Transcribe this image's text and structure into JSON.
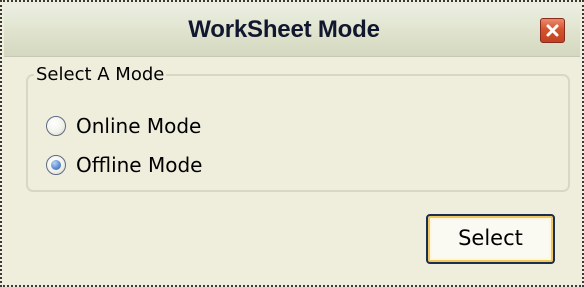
{
  "window": {
    "title": "WorkSheet Mode"
  },
  "mode_group": {
    "label": "Select A Mode",
    "options": [
      {
        "label": "Online Mode",
        "checked": false
      },
      {
        "label": "Offline Mode",
        "checked": true
      }
    ]
  },
  "actions": {
    "select_label": "Select"
  },
  "colors": {
    "dialog_background": "#efeedd",
    "close_button": "#d5542d",
    "radio_selected": "#5d8fd2",
    "default_button_highlight": "#f0c762"
  }
}
